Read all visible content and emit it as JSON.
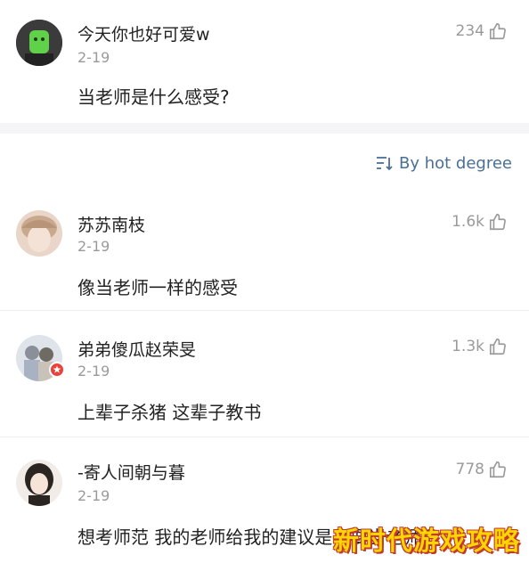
{
  "post": {
    "author": "今天你也好可爱w",
    "date": "2-19",
    "text": "当老师是什么感受?",
    "likes": "234"
  },
  "sort": {
    "label": "By hot degree",
    "icon": "sort-icon"
  },
  "comments": [
    {
      "name": "苏苏南枝",
      "date": "2-19",
      "text": "像当老师一样的感受",
      "likes": "1.6k"
    },
    {
      "name": "弟弟傻瓜赵荣旻",
      "date": "2-19",
      "text": "上辈子杀猪 这辈子教书",
      "likes": "1.3k"
    },
    {
      "name": "-寄人间朝与暮",
      "date": "2-19",
      "text": "想考师范 我的老师给我的建议是不要当老师😅",
      "likes": "778"
    }
  ],
  "watermark": "新时代游戏攻略",
  "colors": {
    "link_blue": "#4a6f95",
    "meta_gray": "#9a9a9a",
    "badge_red": "#e8423b",
    "watermark_yellow": "#ffd400"
  }
}
